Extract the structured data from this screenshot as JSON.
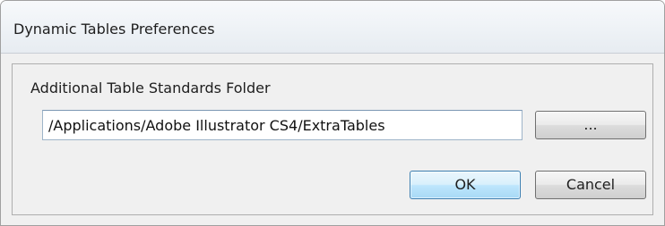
{
  "window": {
    "title": "Dynamic Tables Preferences"
  },
  "form": {
    "folder_label": "Additional Table Standards Folder",
    "folder_path_value": "/Applications/Adobe Illustrator CS4/ExtraTables",
    "browse_label": "..."
  },
  "buttons": {
    "ok_label": "OK",
    "cancel_label": "Cancel"
  },
  "colors": {
    "dialog_background": "#f0f0f0",
    "default_button_border": "#3c7fb1"
  }
}
